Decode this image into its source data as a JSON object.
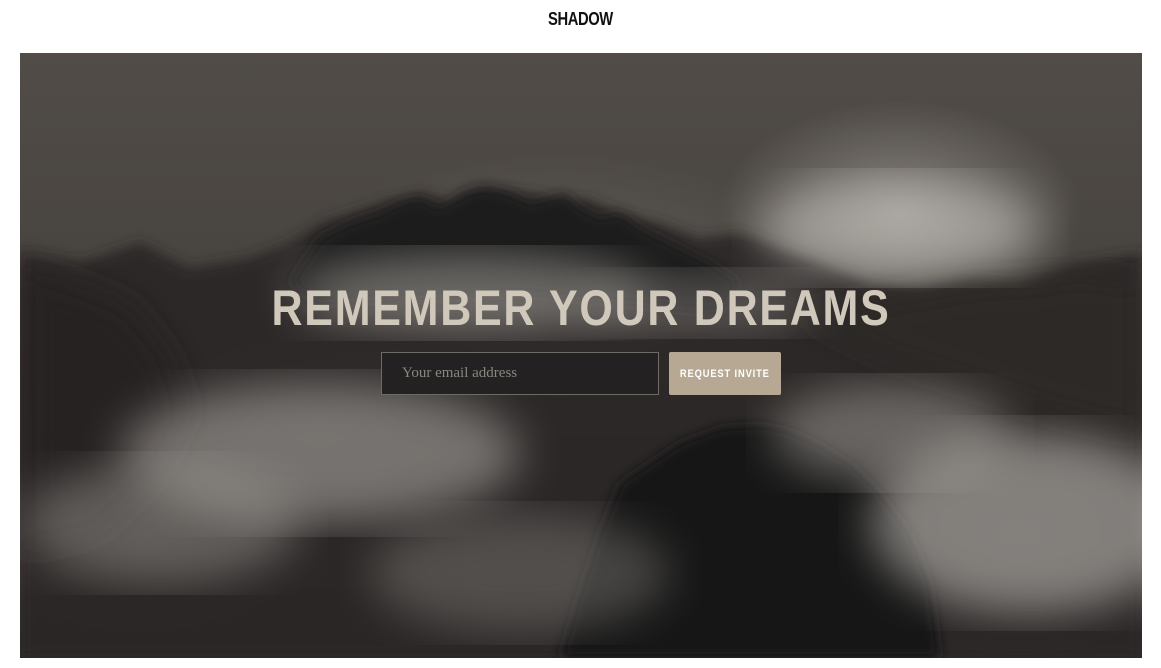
{
  "header": {
    "logo": "SHADOW"
  },
  "hero": {
    "headline": "REMEMBER YOUR DREAMS",
    "email_placeholder": "Your email address",
    "button_label": "REQUEST INVITE"
  },
  "colors": {
    "headline": "#cfc8bb",
    "button_bg": "#b7a894",
    "input_bg": "#232122"
  }
}
